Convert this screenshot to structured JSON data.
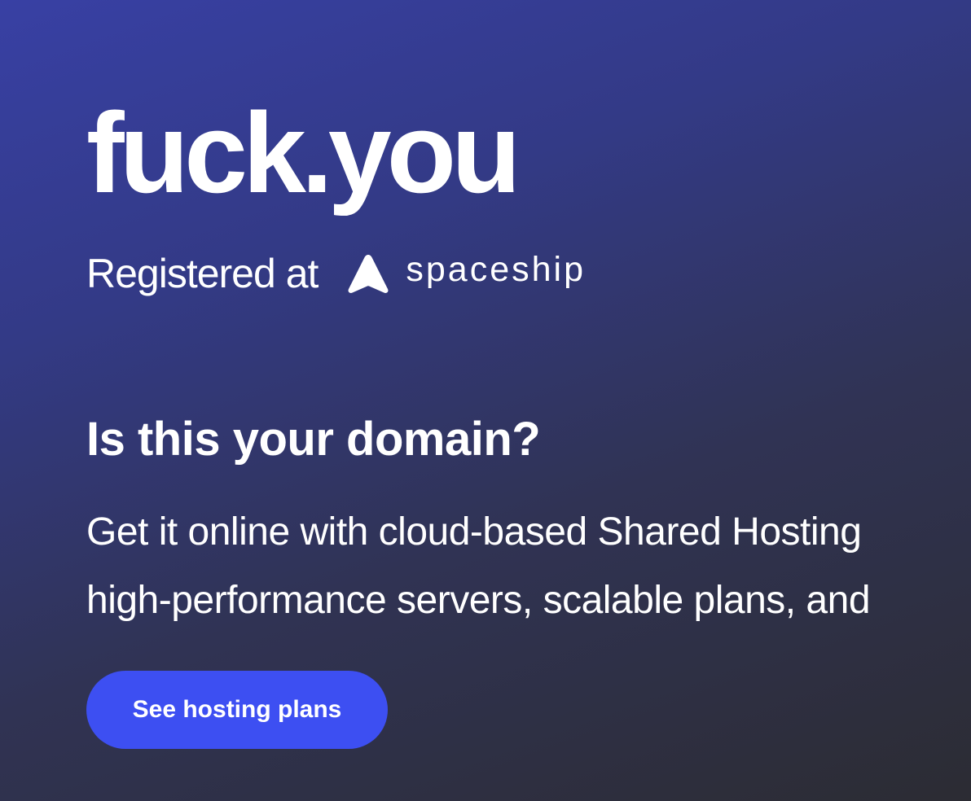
{
  "domain": {
    "name": "fuck.you"
  },
  "registrar": {
    "prefix": "Registered at",
    "name": "spaceship",
    "logo_icon": "spaceship-triangle-icon"
  },
  "pitch": {
    "question": "Is this your domain?",
    "line1": "Get it online with cloud-based Shared Hosting",
    "line2": "high-performance servers, scalable plans, and"
  },
  "cta": {
    "label": "See hosting plans",
    "color": "#3d4ff2"
  },
  "theme": {
    "background_start": "#3840a4",
    "background_end": "#2c2c33",
    "text": "#ffffff"
  }
}
